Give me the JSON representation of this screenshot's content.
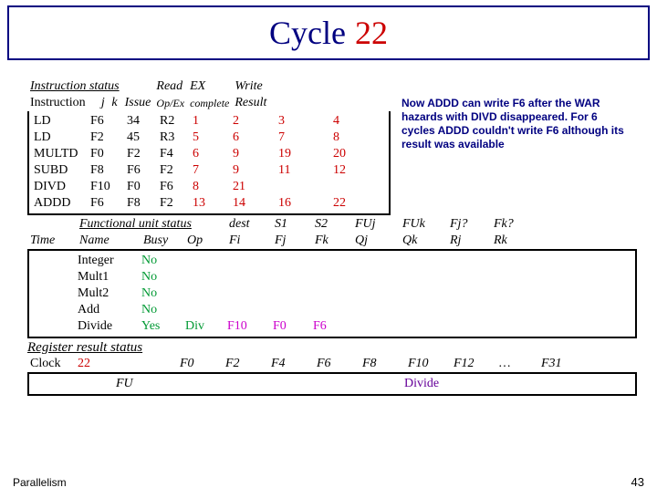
{
  "title": {
    "word1": "Cycle",
    "word2": "22"
  },
  "side_note": "Now ADDD can write F6 after the WAR hazards with DIVD disappeared. For 6 cycles ADDD couldn't write F6 although its result was available",
  "instr_status": {
    "heading": "Instruction status",
    "cols": {
      "instruction": "Instruction",
      "j": "j",
      "k": "k",
      "issue": "Issue",
      "opex": "Op/Ex",
      "complete": "complete",
      "result": "Result",
      "read": "Read",
      "ex": "EX",
      "write": "Write"
    },
    "rows": [
      {
        "op": "LD",
        "dest": "F6",
        "j": "34",
        "k": "R2",
        "issue": "1",
        "read": "2",
        "complete": "3",
        "write": "4"
      },
      {
        "op": "LD",
        "dest": "F2",
        "j": "45",
        "k": "R3",
        "issue": "5",
        "read": "6",
        "complete": "7",
        "write": "8"
      },
      {
        "op": "MULTD",
        "dest": "F0",
        "j": "F2",
        "k": "F4",
        "issue": "6",
        "read": "9",
        "complete": "19",
        "write": "20"
      },
      {
        "op": "SUBD",
        "dest": "F8",
        "j": "F6",
        "k": "F2",
        "issue": "7",
        "read": "9",
        "complete": "11",
        "write": "12"
      },
      {
        "op": "DIVD",
        "dest": "F10",
        "j": "F0",
        "k": "F6",
        "issue": "8",
        "read": "21",
        "complete": "",
        "write": ""
      },
      {
        "op": "ADDD",
        "dest": "F6",
        "j": "F8",
        "k": "F2",
        "issue": "13",
        "read": "14",
        "complete": "16",
        "write": "22"
      }
    ]
  },
  "fu_status": {
    "heading": "Functional unit status",
    "cols": {
      "time": "Time",
      "name": "Name",
      "busy": "Busy",
      "op": "Op",
      "dest": "dest",
      "s1": "S1",
      "s2": "S2",
      "fuj": "FUj",
      "fuk": "FUk",
      "fjq": "Fj?",
      "fkq": "Fk?",
      "fi": "Fi",
      "fj": "Fj",
      "fk": "Fk",
      "qj": "Qj",
      "qk": "Qk",
      "rj": "Rj",
      "rk": "Rk"
    },
    "rows": [
      {
        "time": "",
        "name": "Integer",
        "busy": "No",
        "op": "",
        "fi": "",
        "fj": "",
        "fk": "",
        "qj": "",
        "qk": "",
        "rj": "",
        "rk": ""
      },
      {
        "time": "",
        "name": "Mult1",
        "busy": "No",
        "op": "",
        "fi": "",
        "fj": "",
        "fk": "",
        "qj": "",
        "qk": "",
        "rj": "",
        "rk": ""
      },
      {
        "time": "",
        "name": "Mult2",
        "busy": "No",
        "op": "",
        "fi": "",
        "fj": "",
        "fk": "",
        "qj": "",
        "qk": "",
        "rj": "",
        "rk": ""
      },
      {
        "time": "",
        "name": "Add",
        "busy": "No",
        "op": "",
        "fi": "",
        "fj": "",
        "fk": "",
        "qj": "",
        "qk": "",
        "rj": "",
        "rk": ""
      },
      {
        "time": "",
        "name": "Divide",
        "busy": "Yes",
        "op": "Div",
        "fi": "F10",
        "fj": "F0",
        "fk": "F6",
        "qj": "",
        "qk": "",
        "rj": "",
        "rk": ""
      }
    ]
  },
  "reg_status": {
    "heading": "Register result status",
    "clock_label": "Clock",
    "clock_value": "22",
    "fu_label": "FU",
    "cols": [
      "F0",
      "F2",
      "F4",
      "F6",
      "F8",
      "F10",
      "F12",
      "…",
      "F31"
    ],
    "fu": [
      "",
      "",
      "",
      "",
      "",
      "Divide",
      "",
      "",
      ""
    ]
  },
  "footer": {
    "left": "Parallelism",
    "right": "43"
  }
}
